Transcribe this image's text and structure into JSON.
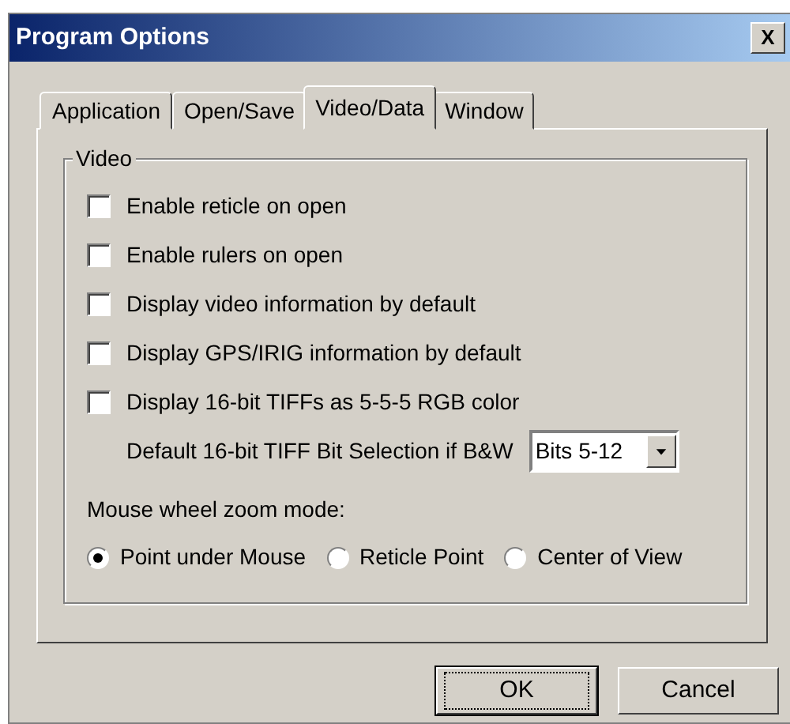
{
  "window": {
    "title": "Program Options",
    "close": "X"
  },
  "tabs": [
    {
      "label": "Application",
      "selected": false
    },
    {
      "label": "Open/Save",
      "selected": false
    },
    {
      "label": "Video/Data",
      "selected": true
    },
    {
      "label": "Window",
      "selected": false
    }
  ],
  "group": {
    "title": "Video",
    "options": [
      {
        "label": "Enable reticle on open",
        "checked": false
      },
      {
        "label": "Enable rulers on open",
        "checked": false
      },
      {
        "label": "Display video information by default",
        "checked": false
      },
      {
        "label": "Display GPS/IRIG information by default",
        "checked": false
      },
      {
        "label": "Display 16-bit TIFFs as 5-5-5 RGB color",
        "checked": false
      }
    ],
    "bit_selection": {
      "label": "Default 16-bit TIFF Bit Selection if B&W",
      "value": "Bits 5-12"
    },
    "zoom_mode": {
      "label": "Mouse wheel zoom mode:",
      "options": [
        {
          "label": "Point under Mouse",
          "selected": true
        },
        {
          "label": "Reticle Point",
          "selected": false
        },
        {
          "label": "Center of View",
          "selected": false
        }
      ]
    }
  },
  "buttons": [
    {
      "label": "OK",
      "default": true
    },
    {
      "label": "Cancel",
      "default": false
    }
  ]
}
